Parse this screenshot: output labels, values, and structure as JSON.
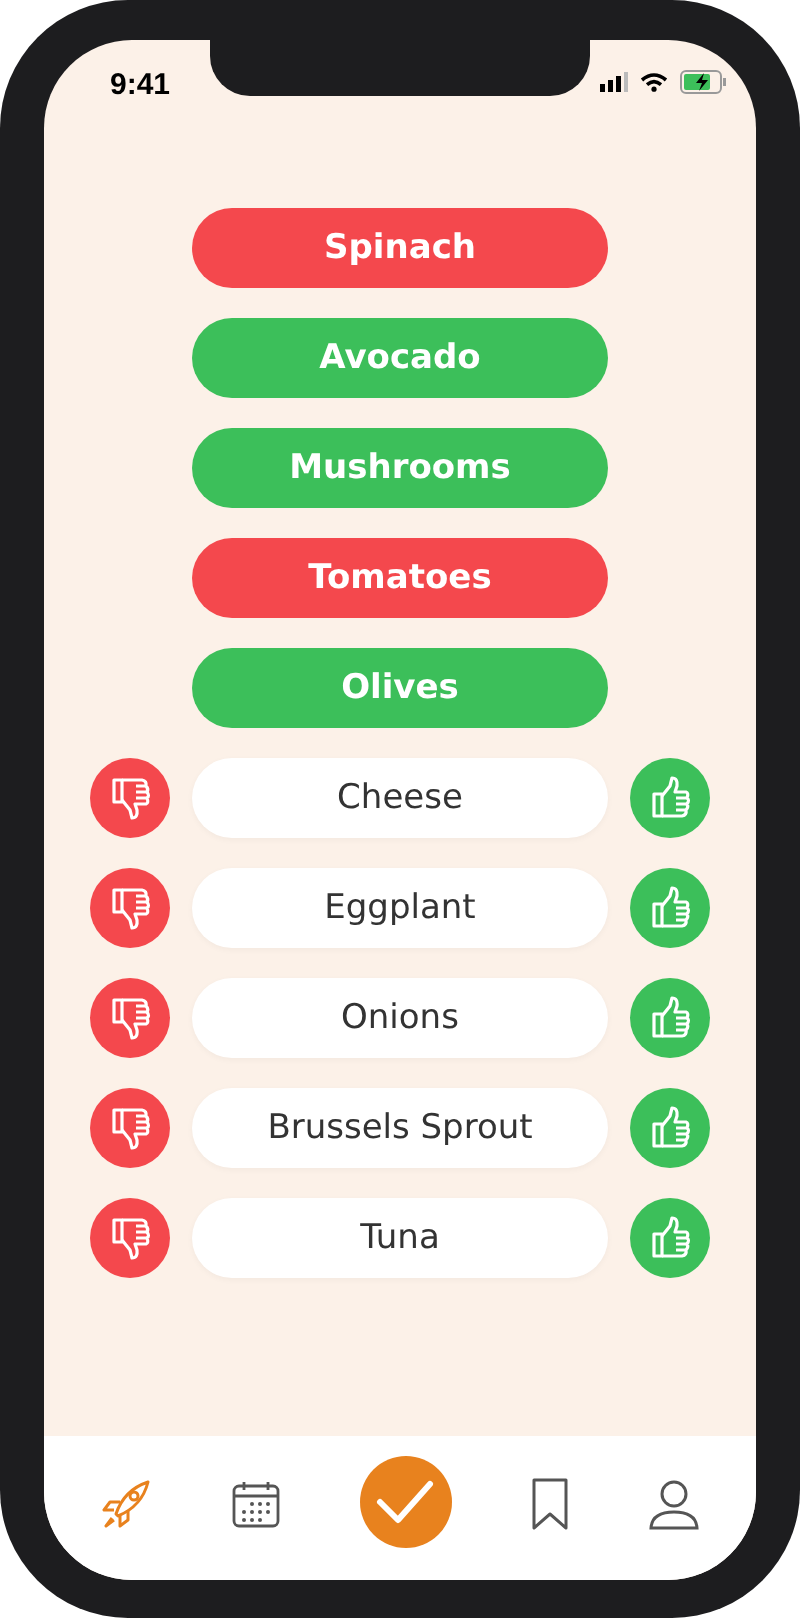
{
  "status_bar": {
    "time": "9:41",
    "charging": true
  },
  "foods": [
    {
      "kind": "rated",
      "label": "Spinach",
      "liked": false
    },
    {
      "kind": "rated",
      "label": "Avocado",
      "liked": true
    },
    {
      "kind": "rated",
      "label": "Mushrooms",
      "liked": true
    },
    {
      "kind": "rated",
      "label": "Tomatoes",
      "liked": false
    },
    {
      "kind": "rated",
      "label": "Olives",
      "liked": true
    },
    {
      "kind": "unrated",
      "label": "Cheese"
    },
    {
      "kind": "unrated",
      "label": "Eggplant"
    },
    {
      "kind": "unrated",
      "label": "Onions"
    },
    {
      "kind": "unrated",
      "label": "Brussels Sprout"
    },
    {
      "kind": "unrated",
      "label": "Tuna"
    }
  ],
  "tab_bar": [
    {
      "kind": "tab",
      "selected": true
    },
    {
      "kind": "tab",
      "selected": false
    },
    {
      "kind": "action"
    },
    {
      "kind": "tab",
      "selected": false
    },
    {
      "kind": "tab",
      "selected": false
    }
  ]
}
